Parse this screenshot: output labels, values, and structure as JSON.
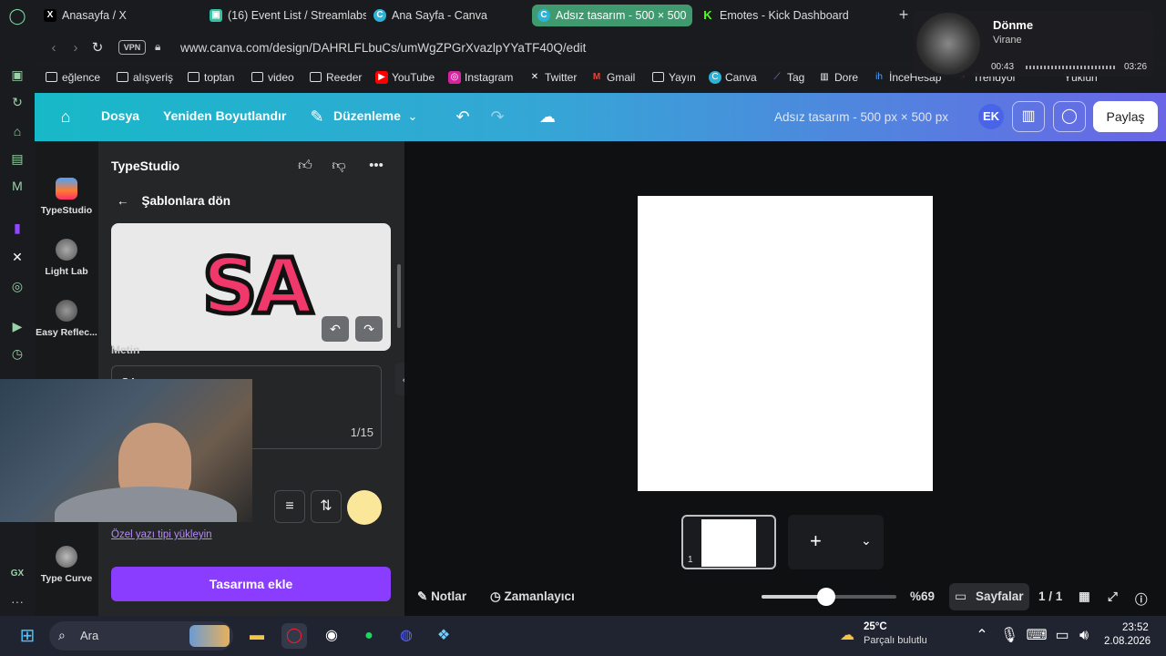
{
  "browser": {
    "tabs": [
      {
        "label": "Anasayfa / X",
        "icon": "x-icon",
        "active": false
      },
      {
        "label": "(16) Event List / Streamlabs",
        "icon": "streamlabs-icon",
        "active": false
      },
      {
        "label": "Ana Sayfa - Canva",
        "icon": "canva-icon",
        "active": false
      },
      {
        "label": "Adsız tasarım - 500 × 500",
        "icon": "canva-icon",
        "active": true
      },
      {
        "label": "Emotes - Kick Dashboard",
        "icon": "kick-icon",
        "active": false
      }
    ],
    "vpn_label": "VPN",
    "url": "www.canva.com/design/DAHRLFLbuCs/umWgZPGrXvazlpYYaTF40Q/edit",
    "bookmarks": [
      "eğlence",
      "alışveriş",
      "toptan",
      "video",
      "Reeder",
      "YouTube",
      "Instagram",
      "Twitter",
      "Gmail",
      "Yayın",
      "Canva",
      "Tag",
      "Dore",
      "İnceHesap",
      "Trendyol",
      "Yüklün"
    ]
  },
  "media": {
    "title": "Dönme",
    "artist": "Virane",
    "elapsed": "00:43",
    "duration": "03:26"
  },
  "header": {
    "file": "Dosya",
    "resize": "Yeniden Boyutlandır",
    "edit": "Düzenleme",
    "doc_title": "Adsız tasarım - 500 px × 500 px",
    "avatar": "EK",
    "share": "Paylaş"
  },
  "apprail": {
    "items": [
      "TypeStudio",
      "Light Lab",
      "Easy Reflec...",
      "Type Curve"
    ]
  },
  "panel": {
    "title": "TypeStudio",
    "back": "Şablonlara dön",
    "preview_text": "SA",
    "text_label": "Metin",
    "text_value": "SA",
    "counter": "1/15",
    "font_link": "Özel yazı tipi yükleyin",
    "add_button": "Tasarıma ekle"
  },
  "canvas": {
    "page_number": "1",
    "notes": "Notlar",
    "timer": "Zamanlayıcı",
    "zoom": "%69",
    "zoom_fraction": 0.48,
    "pages": "Sayfalar",
    "page_count": "1 / 1"
  },
  "taskbar": {
    "search": "Ara",
    "weather_temp": "25°C",
    "weather_desc": "Parçalı bulutlu",
    "time": "23:52",
    "date": "2.08.2026"
  },
  "colors": {
    "accent": "#8b3dff",
    "header_start": "#17b9c8",
    "header_end": "#6a66e6",
    "active_tab": "#3f9a6f",
    "text_color_swatch": "#fbe79a"
  }
}
